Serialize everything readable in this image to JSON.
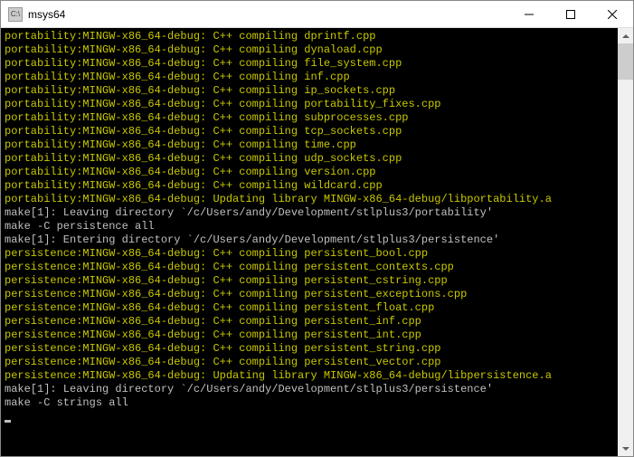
{
  "window": {
    "title": "msys64",
    "icon_label": "C:\\"
  },
  "scrollbar": {
    "position": "top"
  },
  "terminal": {
    "lines": [
      {
        "c": "y",
        "t": "portability:MINGW-x86_64-debug: C++ compiling dprintf.cpp"
      },
      {
        "c": "y",
        "t": "portability:MINGW-x86_64-debug: C++ compiling dynaload.cpp"
      },
      {
        "c": "y",
        "t": "portability:MINGW-x86_64-debug: C++ compiling file_system.cpp"
      },
      {
        "c": "y",
        "t": "portability:MINGW-x86_64-debug: C++ compiling inf.cpp"
      },
      {
        "c": "y",
        "t": "portability:MINGW-x86_64-debug: C++ compiling ip_sockets.cpp"
      },
      {
        "c": "y",
        "t": "portability:MINGW-x86_64-debug: C++ compiling portability_fixes.cpp"
      },
      {
        "c": "y",
        "t": "portability:MINGW-x86_64-debug: C++ compiling subprocesses.cpp"
      },
      {
        "c": "y",
        "t": "portability:MINGW-x86_64-debug: C++ compiling tcp_sockets.cpp"
      },
      {
        "c": "y",
        "t": "portability:MINGW-x86_64-debug: C++ compiling time.cpp"
      },
      {
        "c": "y",
        "t": "portability:MINGW-x86_64-debug: C++ compiling udp_sockets.cpp"
      },
      {
        "c": "y",
        "t": "portability:MINGW-x86_64-debug: C++ compiling version.cpp"
      },
      {
        "c": "y",
        "t": "portability:MINGW-x86_64-debug: C++ compiling wildcard.cpp"
      },
      {
        "c": "y",
        "t": "portability:MINGW-x86_64-debug: Updating library MINGW-x86_64-debug/libportability.a"
      },
      {
        "c": "w",
        "t": "make[1]: Leaving directory `/c/Users/andy/Development/stlplus3/portability'"
      },
      {
        "c": "w",
        "t": "make -C persistence all"
      },
      {
        "c": "w",
        "t": "make[1]: Entering directory `/c/Users/andy/Development/stlplus3/persistence'"
      },
      {
        "c": "y",
        "t": "persistence:MINGW-x86_64-debug: C++ compiling persistent_bool.cpp"
      },
      {
        "c": "y",
        "t": "persistence:MINGW-x86_64-debug: C++ compiling persistent_contexts.cpp"
      },
      {
        "c": "y",
        "t": "persistence:MINGW-x86_64-debug: C++ compiling persistent_cstring.cpp"
      },
      {
        "c": "y",
        "t": "persistence:MINGW-x86_64-debug: C++ compiling persistent_exceptions.cpp"
      },
      {
        "c": "y",
        "t": "persistence:MINGW-x86_64-debug: C++ compiling persistent_float.cpp"
      },
      {
        "c": "y",
        "t": "persistence:MINGW-x86_64-debug: C++ compiling persistent_inf.cpp"
      },
      {
        "c": "y",
        "t": "persistence:MINGW-x86_64-debug: C++ compiling persistent_int.cpp"
      },
      {
        "c": "y",
        "t": "persistence:MINGW-x86_64-debug: C++ compiling persistent_string.cpp"
      },
      {
        "c": "y",
        "t": "persistence:MINGW-x86_64-debug: C++ compiling persistent_vector.cpp"
      },
      {
        "c": "y",
        "t": "persistence:MINGW-x86_64-debug: Updating library MINGW-x86_64-debug/libpersistence.a"
      },
      {
        "c": "w",
        "t": "make[1]: Leaving directory `/c/Users/andy/Development/stlplus3/persistence'"
      },
      {
        "c": "w",
        "t": "make -C strings all"
      }
    ]
  }
}
